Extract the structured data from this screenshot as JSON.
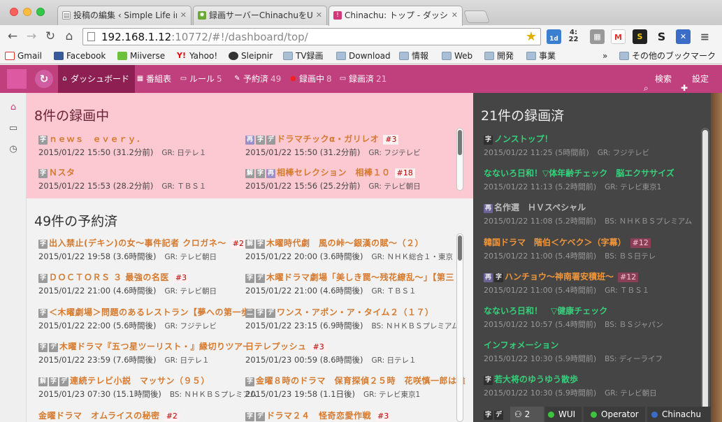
{
  "browser": {
    "tabs": [
      {
        "title": "投稿の編集 ‹ Simple Life in t",
        "favicon": "wordpress-icon"
      },
      {
        "title": "録画サーバーChinachuをUb",
        "favicon": "green-gear-icon"
      },
      {
        "title": "Chinachu: トップ - ダッシュ",
        "favicon": "chinachu-icon"
      }
    ],
    "url_host": "192.168.1.12",
    "url_rest": ":10772/#!/dashboard/top/",
    "bookmarks": [
      {
        "label": "Gmail",
        "icon": "gmail-icon"
      },
      {
        "label": "Facebook",
        "icon": "facebook-icon"
      },
      {
        "label": "Miiverse",
        "icon": "miiverse-icon"
      },
      {
        "label": "Yahoo!",
        "icon": "yahoo-icon"
      },
      {
        "label": "Sleipnir",
        "icon": "sleipnir-icon"
      },
      {
        "label": "TV録画",
        "icon": "folder-icon"
      },
      {
        "label": "Download",
        "icon": "folder-icon"
      },
      {
        "label": "情報",
        "icon": "folder-icon"
      },
      {
        "label": "Web",
        "icon": "folder-icon"
      },
      {
        "label": "開発",
        "icon": "folder-icon"
      },
      {
        "label": "事業",
        "icon": "folder-icon"
      }
    ],
    "overflow_label": "»",
    "other_bookmarks": "その他のブックマーク",
    "ext_clock": "4:\n22",
    "ext_cal": "1d"
  },
  "app": {
    "nav": [
      {
        "label": "ダッシュボード",
        "count": "",
        "icon": "house-icon"
      },
      {
        "label": "番組表",
        "count": "",
        "icon": "calendar-icon"
      },
      {
        "label": "ルール",
        "count": "5",
        "icon": "inbox-icon"
      },
      {
        "label": "予約済",
        "count": "49",
        "icon": "pencil-icon"
      },
      {
        "label": "録画中",
        "count": "8",
        "icon": "record-dot-icon"
      },
      {
        "label": "録画済",
        "count": "21",
        "icon": "monitor-icon"
      }
    ],
    "search_label": "検索",
    "settings_label": "設定",
    "colors": {
      "header": "#c0407d",
      "recording_bg": "#fcc8d2",
      "recorded_bg": "#454545"
    }
  },
  "recording": {
    "title": "8件の録画中",
    "items": [
      {
        "badges": [
          "字"
        ],
        "title": "ｎｅｗｓ　ｅｖｅｒｙ．",
        "ep": "",
        "time": "2015/01/22 15:50 (31.2分前)",
        "ch": "GR: 日テレ１"
      },
      {
        "badges": [
          "再",
          "字",
          "デ"
        ],
        "title": "ドラマチックα・ガリレオ",
        "ep": "#3",
        "time": "2015/01/22 15:50 (31.2分前)",
        "ch": "GR: フジテレビ"
      },
      {
        "badges": [
          "字"
        ],
        "title": "Ｎスタ",
        "ep": "",
        "time": "2015/01/22 15:53 (28.2分前)",
        "ch": "GR: ＴＢＳ１"
      },
      {
        "badges": [
          "解",
          "字",
          "再"
        ],
        "title": "相棒セレクション　相棒１０",
        "ep": "#18",
        "time": "2015/01/22 15:56 (25.2分前)",
        "ch": "GR: テレビ朝日"
      }
    ]
  },
  "reserved": {
    "title": "49件の予約済",
    "items": [
      {
        "badges": [
          "字"
        ],
        "title": "出入禁止(デキン)の女～事件記者 クロガネ～",
        "ep": "#2",
        "time": "2015/01/22 19:58 (3.6時間後)",
        "ch": "GR: テレビ朝日"
      },
      {
        "badges": [
          "解",
          "字"
        ],
        "title": "木曜時代劇　風の峠～銀漢の賦～（２）",
        "ep": "",
        "time": "2015/01/22 20:00 (3.6時間後)",
        "ch": "GR: ＮＨＫ総合１・東京"
      },
      {
        "badges": [
          "字"
        ],
        "title": "ＤＯＣＴＯＲＳ ３ 最強の名医",
        "ep": "#3",
        "time": "2015/01/22 21:00 (4.6時間後)",
        "ch": "GR: テレビ朝日"
      },
      {
        "badges": [
          "字",
          "デ"
        ],
        "title": "木曜ドラマ劇場「美しき罠～残花繚乱～」【第三",
        "ep": "",
        "time": "2015/01/22 21:00 (4.6時間後)",
        "ch": "GR: ＴＢＳ１"
      },
      {
        "badges": [
          "字"
        ],
        "title": "＜木曜劇場＞問題のあるレストラン【夢への第一歩！",
        "ep": "",
        "time": "2015/01/22 22:00 (5.6時間後)",
        "ch": "GR: フジテレビ"
      },
      {
        "badges": [
          "二",
          "字",
          "デ"
        ],
        "title": "ワンス・アポン・ア・タイム２（１７）",
        "ep": "",
        "time": "2015/01/22 23:15 (6.9時間後)",
        "ch": "BS: ＮＨＫＢＳプレミアム"
      },
      {
        "badges": [
          "字",
          "デ"
        ],
        "title": "木曜ドラマ『五つ星ツーリスト・』縁切りツアー",
        "ep": "",
        "time": "2015/01/22 23:59 (7.6時間後)",
        "ch": "GR: 日テレ１"
      },
      {
        "badges": [],
        "title": "日テレプッシュ",
        "ep": "#3",
        "time": "2015/01/23 00:59 (8.6時間後)",
        "ch": "GR: 日テレ１"
      },
      {
        "badges": [
          "解",
          "字",
          "デ"
        ],
        "title": "連続テレビ小説　マッサン（９５）",
        "ep": "",
        "time": "2015/01/23 07:30 (15.1時間後)",
        "ch": "BS: ＮＨＫＢＳプレミアム"
      },
      {
        "badges": [
          "字"
        ],
        "title": "金曜８時のドラマ　保育探偵２５時　花咲慎一郎は難",
        "ep": "",
        "time": "2015/01/23 19:58 (1.1日後)",
        "ch": "GR: テレビ東京1"
      },
      {
        "badges": [],
        "title": "金曜ドラマ　オムライスの秘密",
        "ep": "#2",
        "time": "",
        "ch": ""
      },
      {
        "badges": [
          "字",
          "デ"
        ],
        "title": "ドラマ２４　怪奇恋愛作戦",
        "ep": "#3",
        "time": "",
        "ch": ""
      }
    ]
  },
  "recorded": {
    "title": "21件の録画済",
    "items": [
      {
        "badges": [
          "字"
        ],
        "title": "ノンストップ！",
        "ep": "",
        "color": "green",
        "time": "2015/01/22 11:25 (5時間前)",
        "ch": "GR: フジテレビ"
      },
      {
        "badges": [],
        "title": "なないろ日和！▽体年齢チェック　脳エクササイズ",
        "ep": "",
        "color": "green",
        "time": "2015/01/22 11:13 (5.2時間前)",
        "ch": "GR: テレビ東京1"
      },
      {
        "badges": [
          "再"
        ],
        "title": "名作選　ＨＶスペシャル",
        "ep": "",
        "color": "gray",
        "time": "2015/01/22 11:08 (5.2時間前)",
        "ch": "BS: ＮＨＫＢＳプレミアム"
      },
      {
        "badges": [],
        "title": "韓国ドラマ　階伯＜ケベク＞（字幕）",
        "ep": "#12",
        "color": "orange",
        "time": "2015/01/22 11:00 (5.4時間前)",
        "ch": "BS: ＢＳ日テレ"
      },
      {
        "badges": [
          "再",
          "字"
        ],
        "title": "ハンチョウ～神南署安積班～",
        "ep": "#12",
        "color": "orange",
        "time": "2015/01/22 11:00 (5.4時間前)",
        "ch": "GR: ＴＢＳ１"
      },
      {
        "badges": [],
        "title": "なないろ日和！　▽健康チェック",
        "ep": "",
        "color": "green",
        "time": "2015/01/22 10:57 (5.4時間前)",
        "ch": "BS: ＢＳジャパン"
      },
      {
        "badges": [],
        "title": "インフォメーション",
        "ep": "",
        "color": "green",
        "time": "2015/01/22 10:30 (5.9時間前)",
        "ch": "BS: ディーライフ"
      },
      {
        "badges": [
          "字"
        ],
        "title": "若大将のゆうゆう散歩",
        "ep": "",
        "color": "green",
        "time": "2015/01/22 10:30 (5.9時間前)",
        "ch": "GR: テレビ朝日"
      },
      {
        "badges": [
          "字",
          "デ"
        ],
        "title": "",
        "ep": "",
        "color": "green",
        "time": "",
        "ch": ""
      }
    ]
  },
  "status": {
    "users": "2",
    "wui": "WUI",
    "operator": "Operator",
    "chinachu": "Chinachu"
  }
}
